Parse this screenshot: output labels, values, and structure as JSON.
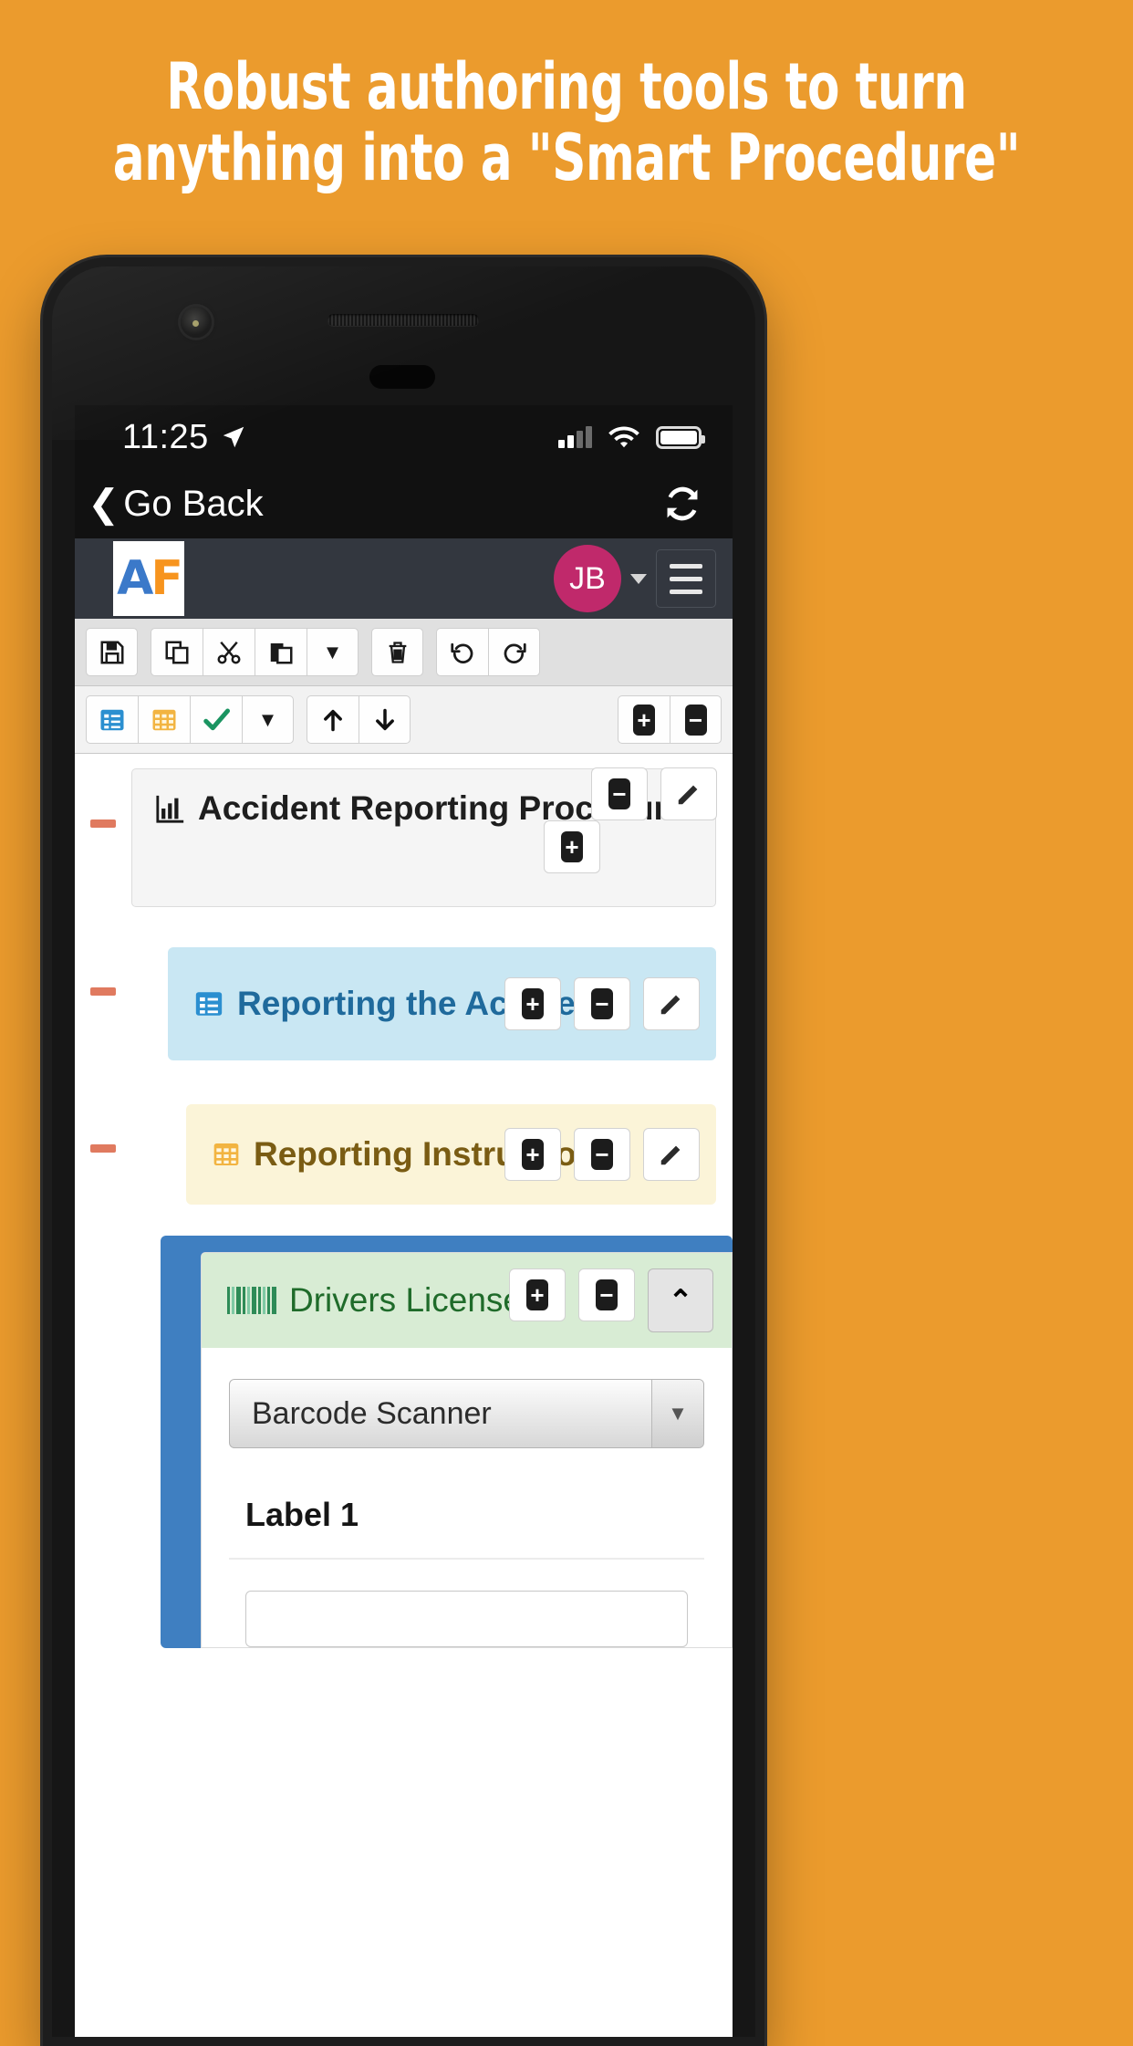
{
  "headline": {
    "line1": "Robust authoring tools to turn",
    "line2": "anything into a \"Smart Procedure\""
  },
  "colors": {
    "background": "#eb9b2d",
    "header_bar": "#33373f",
    "avatar": "#c0296b",
    "blue_card": "#c9e7f3",
    "yellow_card": "#fbf4d8",
    "green_card": "#d8ecd4",
    "blue_container": "#3f7fc1",
    "tree_dash": "#e07a5f"
  },
  "statusbar": {
    "time": "11:25",
    "location_icon": "location-arrow-icon",
    "signal_icon": "cellular-signal-icon",
    "wifi_icon": "wifi-icon",
    "battery_icon": "battery-full-icon"
  },
  "navbar": {
    "back_label": "Go Back",
    "back_chevron": "chevron-left-icon",
    "refresh_icon": "refresh-icon"
  },
  "appheader": {
    "logo_a": "A",
    "logo_f": "F",
    "avatar_initials": "JB",
    "caret_icon": "chevron-down-icon",
    "menu_icon": "hamburger-menu-icon"
  },
  "toolbar1": [
    {
      "name": "save-button",
      "glyph": "💾"
    },
    {
      "name": "copy-button",
      "glyph": "❐"
    },
    {
      "name": "cut-button",
      "glyph": "✂"
    },
    {
      "name": "paste-button",
      "glyph": "📋"
    },
    {
      "name": "paste-dropdown-button",
      "glyph": "▼"
    },
    {
      "name": "delete-button",
      "glyph": "🗑"
    },
    {
      "name": "undo-button",
      "glyph": "↶"
    },
    {
      "name": "redo-button",
      "glyph": "↷"
    }
  ],
  "toolbar2": [
    {
      "name": "insert-section-button",
      "glyph": "☰"
    },
    {
      "name": "insert-table-button",
      "glyph": "▦"
    },
    {
      "name": "insert-check-button",
      "glyph": "✔"
    },
    {
      "name": "insert-dropdown-button",
      "glyph": "▼"
    },
    {
      "name": "move-up-button",
      "glyph": "↑"
    },
    {
      "name": "move-down-button",
      "glyph": "↓"
    },
    {
      "name": "expand-all-button",
      "glyph": "+"
    },
    {
      "name": "collapse-all-button",
      "glyph": "−"
    }
  ],
  "tree": {
    "root": {
      "title": "Accident Reporting Procedures",
      "icon": "bar-chart-icon",
      "buttons": {
        "minus": "−",
        "plus": "+",
        "edit": "✎"
      }
    },
    "section_blue": {
      "title": "Reporting the Acciden…",
      "icon": "section-list-icon",
      "buttons": {
        "plus": "+",
        "minus": "−",
        "edit": "✎"
      }
    },
    "section_yellow": {
      "title": "Reporting Instructions",
      "icon": "table-grid-icon",
      "buttons": {
        "plus": "+",
        "minus": "−",
        "edit": "✎"
      }
    },
    "section_green": {
      "title": "Drivers License",
      "icon": "barcode-icon",
      "buttons": {
        "plus": "+",
        "minus": "−",
        "collapse": "⌃"
      }
    }
  },
  "form": {
    "select_value": "Barcode Scanner",
    "select_arrow": "▼",
    "label1": "Label 1",
    "input1_value": ""
  }
}
